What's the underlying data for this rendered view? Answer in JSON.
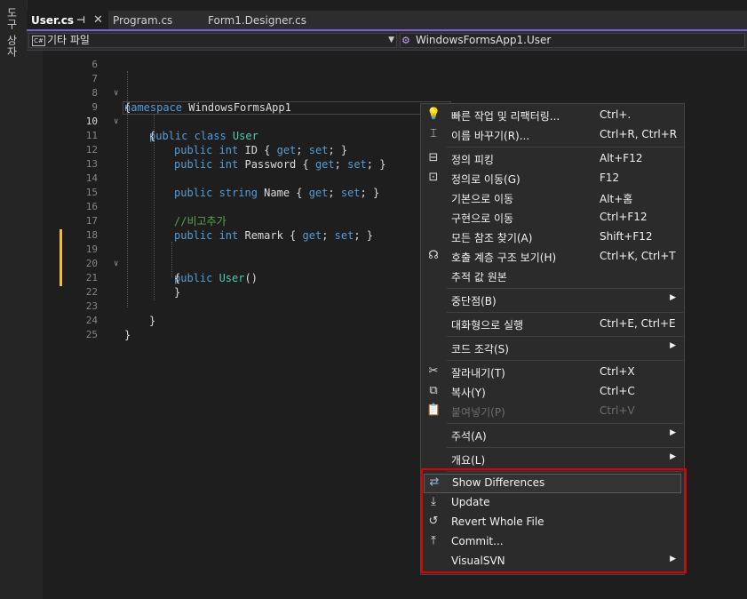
{
  "toolbox": {
    "label": "도구 상자"
  },
  "tabs": [
    {
      "label": "User.cs",
      "active": true
    },
    {
      "label": "Program.cs",
      "active": false
    },
    {
      "label": "Form1.Designer.cs",
      "active": false
    }
  ],
  "nav": {
    "project": "기타 파일",
    "class_path": "WindowsFormsApp1.User"
  },
  "code": {
    "ln0": "6",
    "ln7": "7",
    "ln8": "8",
    "ln9": "9",
    "ln10": "10",
    "ln11": "11",
    "ln12": "12",
    "ln13": "13",
    "ln14": "14",
    "ln15": "15",
    "ln16": "16",
    "ln17": "17",
    "ln18": "18",
    "ln19": "19",
    "ln20": "20",
    "ln21": "21",
    "ln22": "22",
    "ln23": "23",
    "ln24": "24",
    "ln25": "25",
    "l7_kw": "namespace",
    "l7_rest": " WindowsFormsApp1",
    "l8": "{",
    "l9_kw": "public class",
    "l9_ty": " User",
    "l10": "{",
    "l11_kw": "public int",
    "l11_name": " ID { ",
    "l11_get": "get",
    "l11_semi": "; ",
    "l11_set": "set",
    "l11_end": "; }",
    "l12_kw": "public int",
    "l12_name": " Password { ",
    "l12_get": "get",
    "l12_semi": "; ",
    "l12_set": "set",
    "l12_end": "; }",
    "l14_kw": "public string",
    "l14_name": " Name { ",
    "l14_get": "get",
    "l14_semi": "; ",
    "l14_set": "set",
    "l14_end": "; }",
    "l16_cm": "//비고추가",
    "l17_kw": "public int",
    "l17_name": " Remark { ",
    "l17_get": "get",
    "l17_semi": "; ",
    "l17_set": "set",
    "l17_end": "; }",
    "l19_kw": "public",
    "l19_ty": " User",
    "l19_end": "()",
    "l20": "{",
    "l21": "}",
    "l23": "}",
    "l24": "}"
  },
  "menu": {
    "quick_actions": {
      "label": "빠른 작업 및 리팩터링...",
      "shortcut": "Ctrl+."
    },
    "rename": {
      "label": "이름 바꾸기(R)...",
      "shortcut": "Ctrl+R, Ctrl+R"
    },
    "peek": {
      "label": "정의 피킹",
      "shortcut": "Alt+F12"
    },
    "goto_def": {
      "label": "정의로 이동(G)",
      "shortcut": "F12"
    },
    "goto_base": {
      "label": "기본으로 이동",
      "shortcut": "Alt+홈"
    },
    "goto_impl": {
      "label": "구현으로 이동",
      "shortcut": "Ctrl+F12"
    },
    "find_refs": {
      "label": "모든 참조 찾기(A)",
      "shortcut": "Shift+F12"
    },
    "call_hierarchy": {
      "label": "호출 계층 구조 보기(H)",
      "shortcut": "Ctrl+K, Ctrl+T"
    },
    "track_value": {
      "label": "추적 값 원본"
    },
    "breakpoint": {
      "label": "중단점(B)"
    },
    "interactive": {
      "label": "대화형으로 실행",
      "shortcut": "Ctrl+E, Ctrl+E"
    },
    "snippet": {
      "label": "코드 조각(S)"
    },
    "cut": {
      "label": "잘라내기(T)",
      "shortcut": "Ctrl+X"
    },
    "copy": {
      "label": "복사(Y)",
      "shortcut": "Ctrl+C"
    },
    "paste": {
      "label": "붙여넣기(P)",
      "shortcut": "Ctrl+V"
    },
    "annotation": {
      "label": "주석(A)"
    },
    "outlining": {
      "label": "개요(L)"
    },
    "show_diff": {
      "label": "Show Differences"
    },
    "update": {
      "label": "Update"
    },
    "revert": {
      "label": "Revert Whole File"
    },
    "commit": {
      "label": "Commit..."
    },
    "visualsvn": {
      "label": "VisualSVN"
    }
  },
  "colors": {
    "accent": "#7b61c9",
    "highlight_border": "#e00000",
    "change_marker": "#f0c024"
  }
}
